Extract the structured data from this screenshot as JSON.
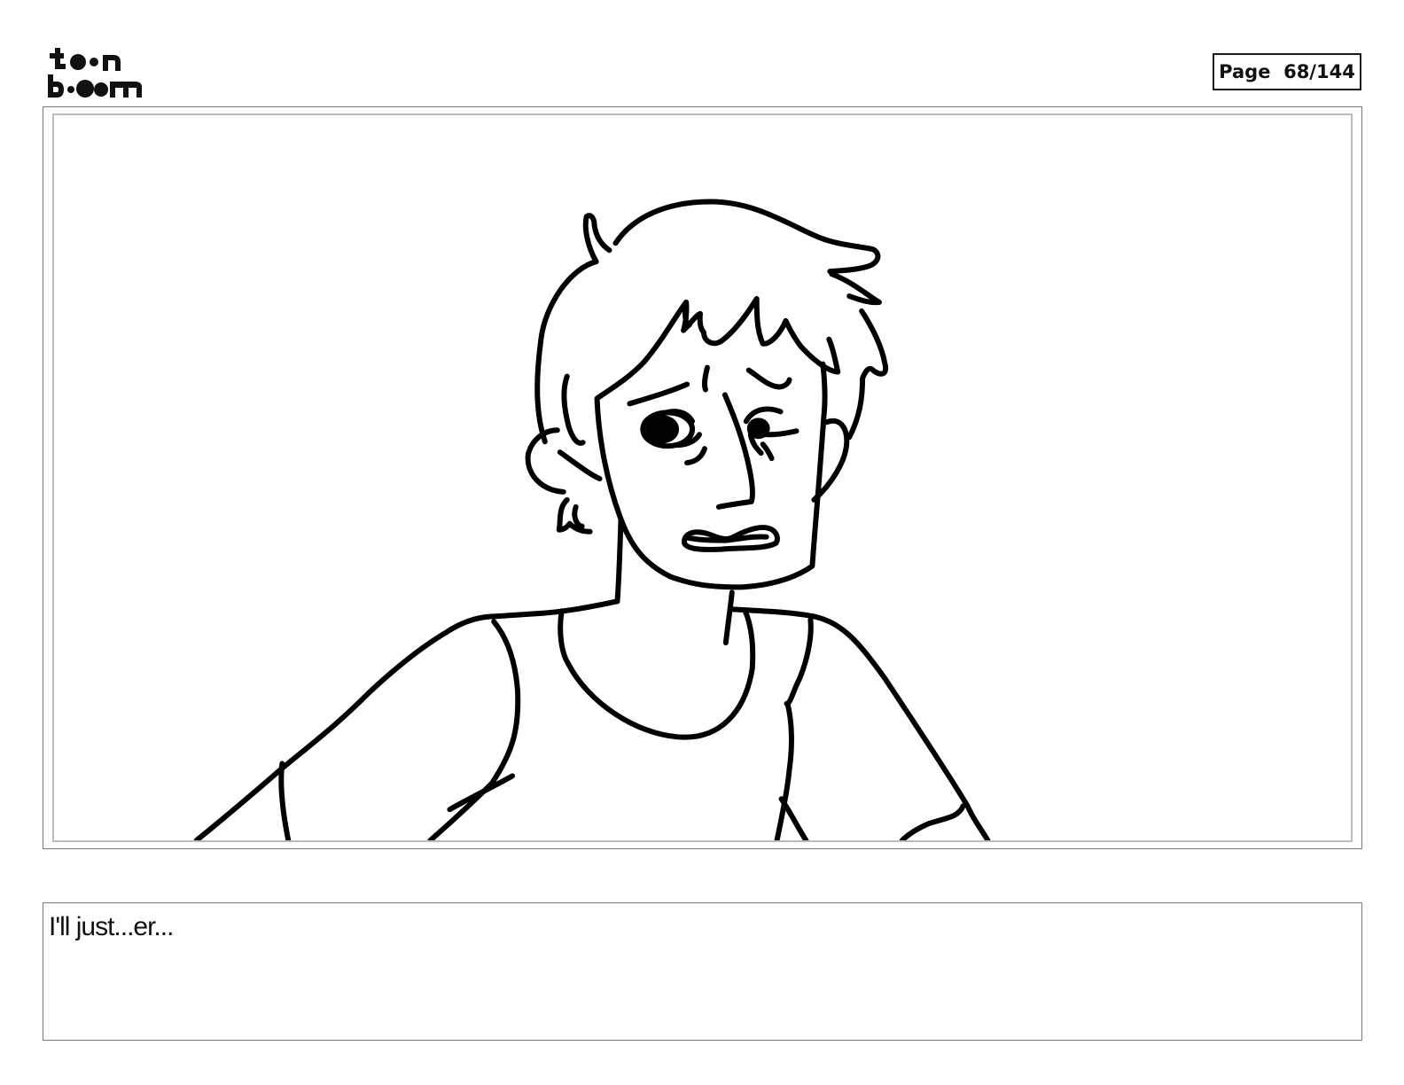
{
  "header": {
    "logo": {
      "line1": "toon",
      "line2": "boom",
      "icon": "toonboom-logo"
    },
    "page_label": "Page",
    "page_number": "68/144"
  },
  "panel": {
    "drawing": "character-sketch",
    "dialogue": "I'll just...er..."
  }
}
